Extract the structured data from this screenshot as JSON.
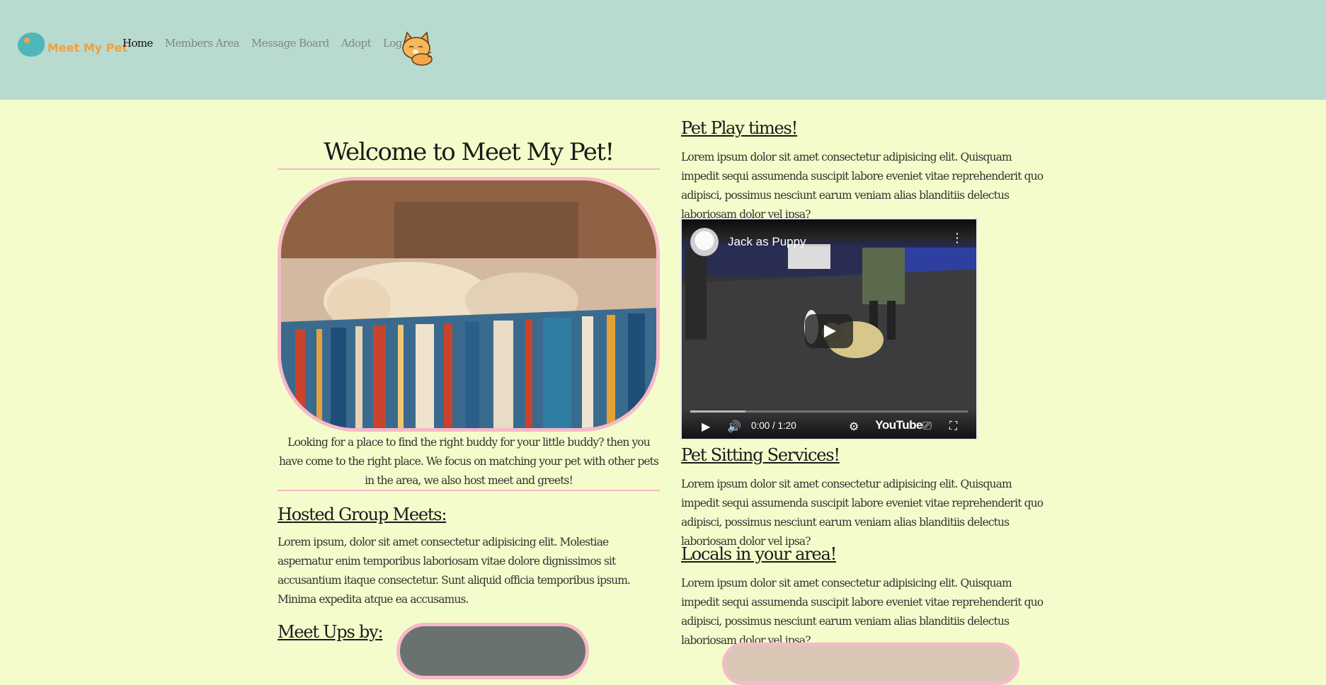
{
  "header": {
    "brand": "Meet My Pet",
    "nav": [
      {
        "label": "Home",
        "active": true
      },
      {
        "label": "Members Area"
      },
      {
        "label": "Message Board"
      },
      {
        "label": "Adopt"
      },
      {
        "label": "Log Out"
      }
    ],
    "logo_icon": "paw-bubble-icon",
    "mascot_icon": "cat-mascot-icon"
  },
  "left": {
    "welcome_title": "Welcome to Meet My Pet!",
    "intro": "Looking for a place to find the right buddy for your little buddy? then you have come to the right place. We focus on matching your pet with other pets in the area, we also host meet and greets!",
    "hosted_title": "Hosted Group Meets:",
    "hosted_text": "Lorem ipsum, dolor sit amet consectetur adipisicing elit. Molestiae aspernatur enim temporibus laboriosam vitae dolore dignissimos sit accusantium itaque consectetur. Sunt aliquid officia temporibus ipsum. Minima expedita atque ea accusamus.",
    "meetups_title": "Meet Ups by:"
  },
  "right": {
    "play_title": "Pet Play times!",
    "play_text": "Lorem ipsum dolor sit amet consectetur adipisicing elit. Quisquam impedit sequi assumenda suscipit labore eveniet vitae reprehenderit quo adipisci, possimus nesciunt earum veniam alias blanditiis delectus laboriosam dolor vel ipsa?",
    "sitting_title": "Pet Sitting Services!",
    "sitting_text": "Lorem ipsum dolor sit amet consectetur adipisicing elit. Quisquam impedit sequi assumenda suscipit labore eveniet vitae reprehenderit quo adipisci, possimus nesciunt earum veniam alias blanditiis delectus laboriosam dolor vel ipsa?",
    "locals_title": "Locals in your area!",
    "locals_text": "Lorem ipsum dolor sit amet consectetur adipisicing elit. Quisquam impedit sequi assumenda suscipit labore eveniet vitae reprehenderit quo adipisci, possimus nesciunt earum veniam alias blanditiis delectus laboriosam dolor vel ipsa?"
  },
  "video": {
    "title": "Jack as Puppy",
    "time": "0:00 / 1:20",
    "platform": "YouTube",
    "progress": 0.2
  },
  "colors": {
    "header_bg": "#b9dacf",
    "page_bg": "#f4fccb",
    "accent_pink": "#f7b9c8",
    "brand_orange": "#f0a040",
    "logo_teal": "#4fb6b9"
  }
}
